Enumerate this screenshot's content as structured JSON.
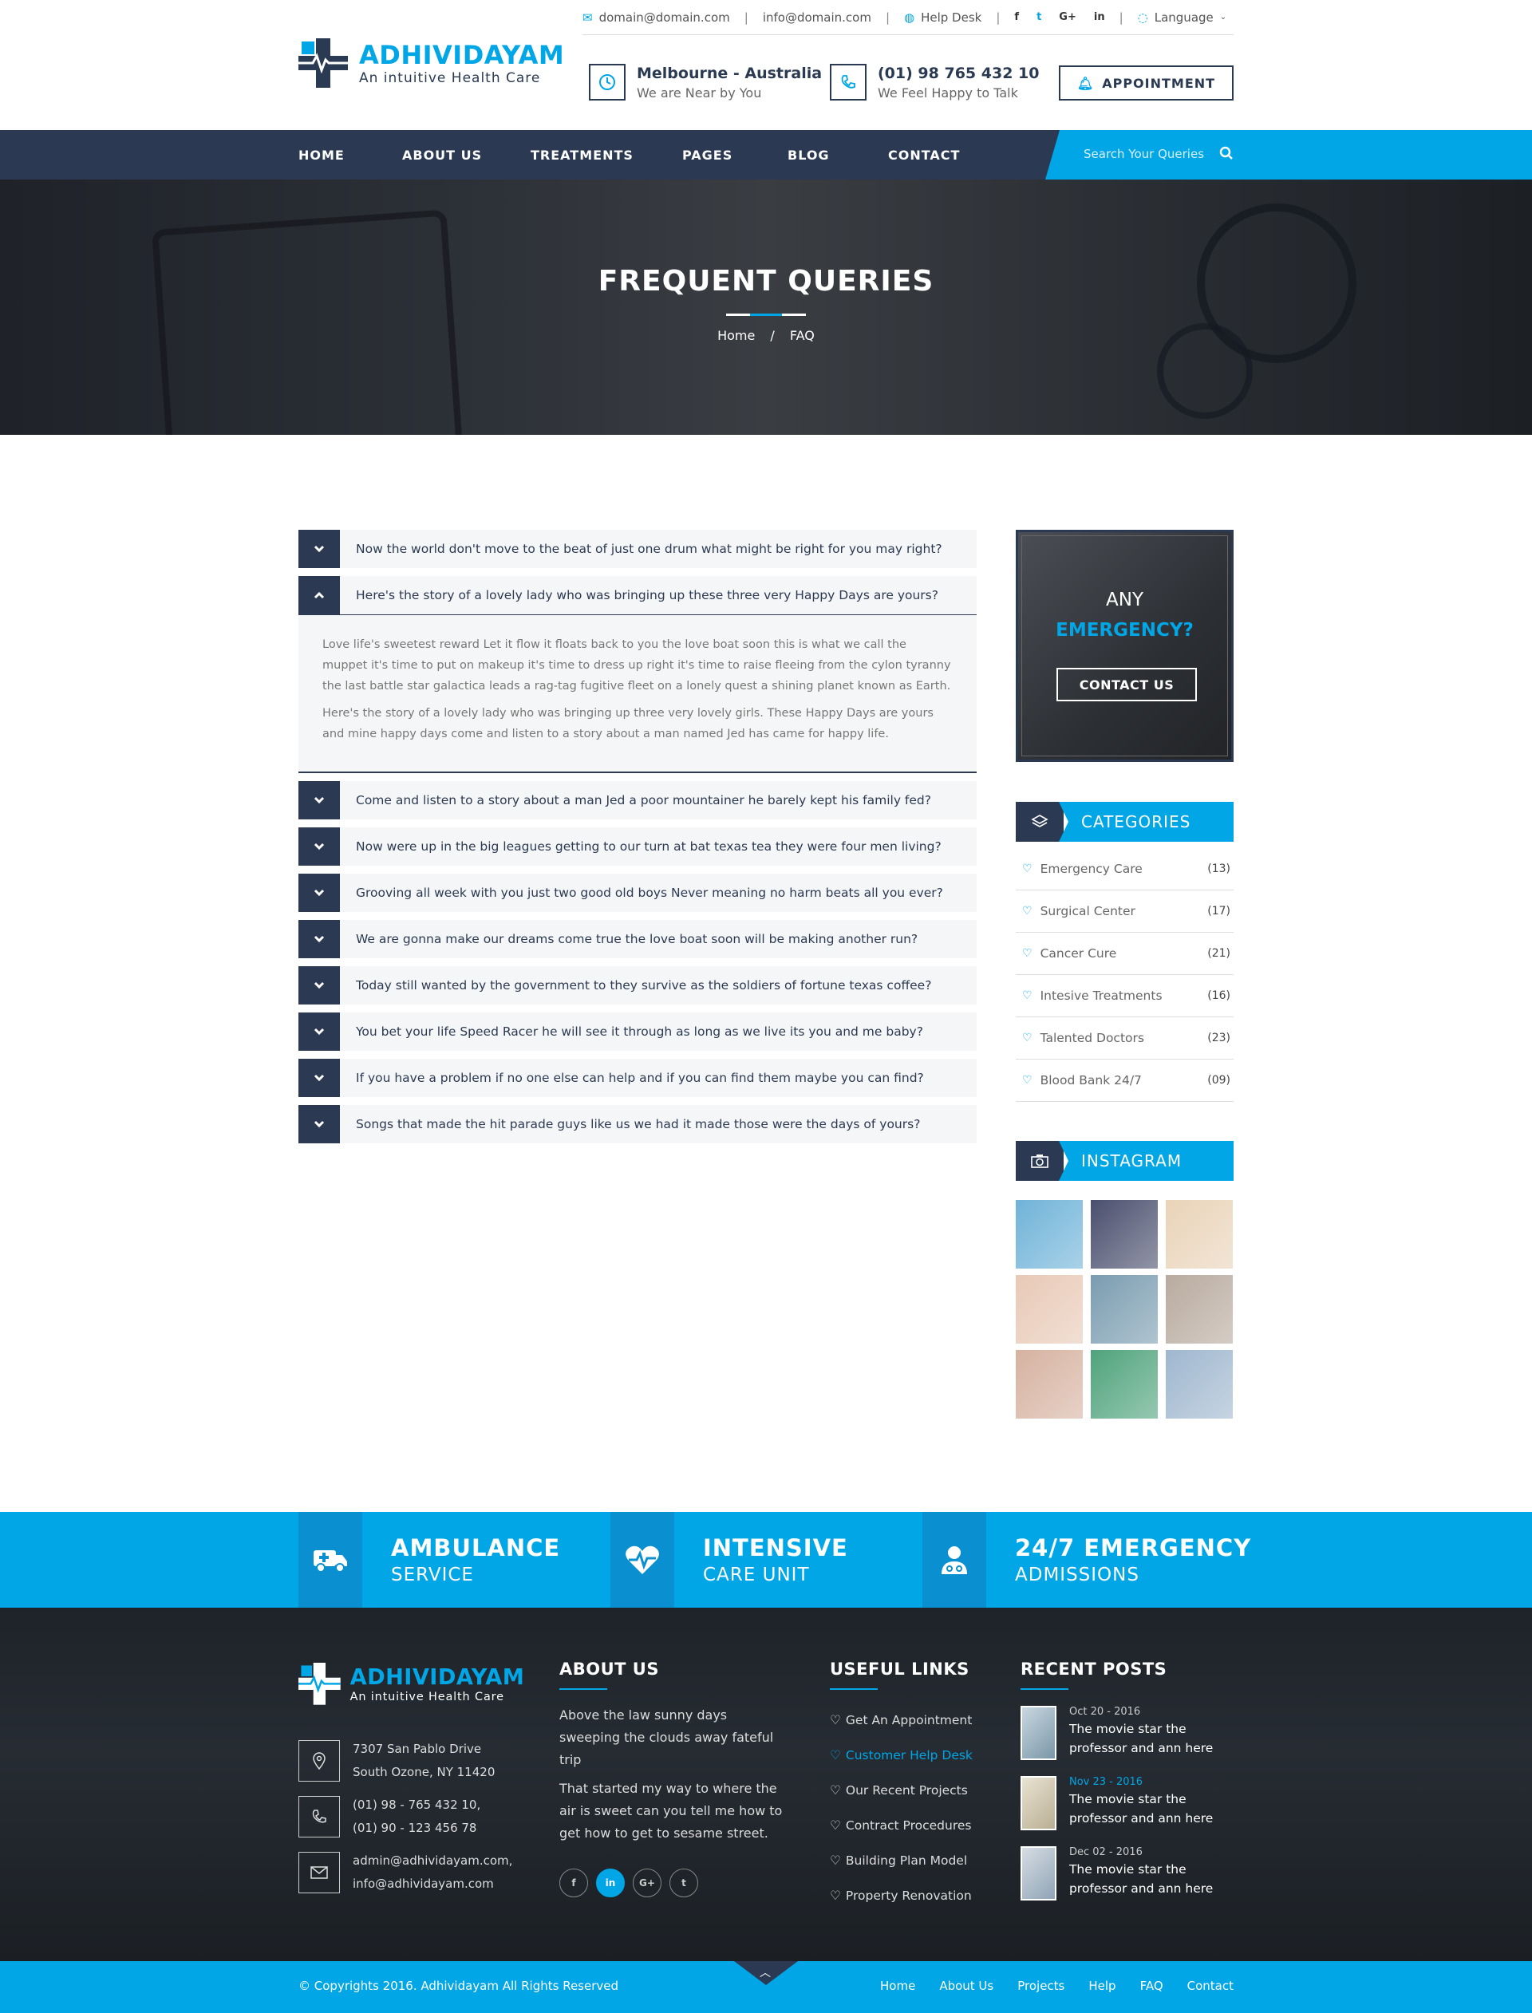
{
  "topbar": {
    "email1": "domain@domain.com",
    "email2": "info@domain.com",
    "help": "Help Desk",
    "social": [
      "f",
      "t",
      "G+",
      "in"
    ],
    "language": "Language"
  },
  "brand": {
    "name": "ADHIVIDAYAM",
    "tagline": "An intuitive Health Care"
  },
  "header": {
    "location_title": "Melbourne - Australia",
    "location_sub": "We are Near by You",
    "phone_title": "(01) 98 765 432 10",
    "phone_sub": "We Feel Happy to Talk",
    "appointment": "APPOINTMENT"
  },
  "nav": {
    "items": [
      "HOME",
      "ABOUT US",
      "TREATMENTS",
      "PAGES",
      "BLOG",
      "CONTACT"
    ],
    "search_placeholder": "Search Your Queries"
  },
  "hero": {
    "title": "FREQUENT QUERIES",
    "crumb_home": "Home",
    "crumb_sep": "/",
    "crumb_current": "FAQ"
  },
  "faq": {
    "items": [
      "Now the world don't move to the beat of just one drum what might be right for you may right?",
      "Here's the story of a lovely lady who was bringing up these three very Happy Days are yours?",
      "Come and listen to a story about a man Jed a poor mountainer he barely kept his family fed?",
      "Now were up in the big leagues getting to our turn at bat texas tea they were four men living?",
      "Grooving all week with you just two good old boys Never meaning no harm beats all you ever?",
      "We are gonna make our dreams come true the love boat soon will be making another run?",
      "Today still wanted by the government to they survive as the soldiers of fortune texas coffee?",
      "You bet your life Speed Racer he will see it through as long as we live its you and me baby?",
      "If you have a problem if no one else can help and if you can find them maybe you can find?",
      "Songs that made the hit parade guys like us we had it made those were the days of yours?"
    ],
    "answer_p1": "Love life's sweetest reward Let it flow it floats back to you the love boat soon this is what we call the muppet it's time to put on makeup it's time to dress up right it's time to raise fleeing from the cylon tyranny the last battle star  galactica leads a rag-tag fugitive fleet on a lonely quest a shining planet known as Earth.",
    "answer_p2": "Here's the story of a lovely lady who was bringing up three very lovely girls. These Happy Days are yours and mine happy days come and listen to a story about a man named Jed has came for happy life."
  },
  "emergency": {
    "line1": "ANY",
    "line2": "EMERGENCY?",
    "button": "CONTACT US"
  },
  "categories": {
    "title": "CATEGORIES",
    "items": [
      {
        "name": "Emergency Care",
        "count": "(13)"
      },
      {
        "name": "Surgical Center",
        "count": "(17)"
      },
      {
        "name": "Cancer Cure",
        "count": "(21)"
      },
      {
        "name": "Intesive Treatments",
        "count": "(16)"
      },
      {
        "name": "Talented Doctors",
        "count": "(23)"
      },
      {
        "name": "Blood Bank 24/7",
        "count": "(09)"
      }
    ]
  },
  "instagram": {
    "title": "INSTAGRAM",
    "colors": [
      "#6fb3d8",
      "#4a4f6e",
      "#e9d3b8",
      "#e8c9b6",
      "#7a9cb0",
      "#b8aa9e",
      "#d6b2a0",
      "#4fa37c",
      "#9fb7cf"
    ]
  },
  "services": [
    {
      "title": "AMBULANCE",
      "sub": "SERVICE",
      "icon": "ambulance-icon"
    },
    {
      "title": "INTENSIVE",
      "sub": "CARE UNIT",
      "icon": "heartbeat-icon"
    },
    {
      "title": "24/7 EMERGENCY",
      "sub": "ADMISSIONS",
      "icon": "doctor-icon"
    }
  ],
  "footer": {
    "address1": "7307 San Pablo Drive",
    "address2": "South Ozone, NY 11420",
    "phone1": "(01) 98 - 765 432 10,",
    "phone2": "(01) 90 - 123 456 78",
    "mail1": "admin@adhividayam.com,",
    "mail2": "info@adhividayam.com",
    "about_title": "ABOUT US",
    "about_p1": "Above the law sunny days sweeping the clouds away fateful trip",
    "about_p2": "That started my way to where the air is sweet can you tell me how to get how to get to sesame street.",
    "social": [
      "f",
      "in",
      "G+",
      "t"
    ],
    "links_title": "USEFUL LINKS",
    "links": [
      "Get An Appointment",
      "Customer Help Desk",
      "Our Recent Projects",
      "Contract Procedures",
      "Building Plan Model",
      "Property Renovation"
    ],
    "posts_title": "RECENT POSTS",
    "posts": [
      {
        "date": "Oct 20 - 2016",
        "title": "The movie star the professor and ann here"
      },
      {
        "date": "Nov 23 - 2016",
        "title": "The movie star the professor and ann here"
      },
      {
        "date": "Dec 02 - 2016",
        "title": "The movie star the professor and ann here"
      }
    ]
  },
  "bottom": {
    "copyright": "© Copyrights 2016. Adhividayam All Rights Reserved",
    "links": [
      "Home",
      "About Us",
      "Projects",
      "Help",
      "FAQ",
      "Contact"
    ]
  },
  "colors": {
    "accent": "#00a6e6",
    "navy": "#2b3a52"
  }
}
